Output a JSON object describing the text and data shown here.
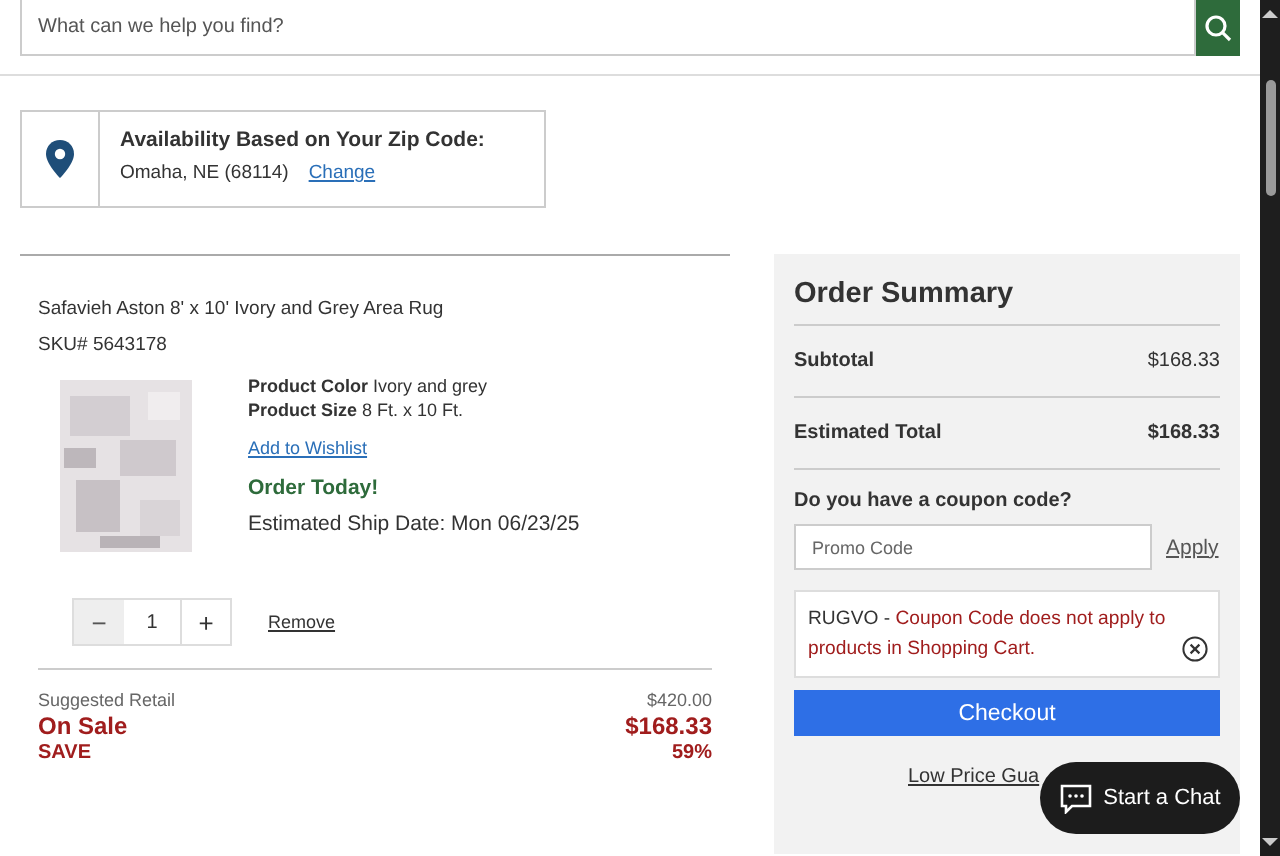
{
  "search": {
    "placeholder": "What can we help you find?"
  },
  "availability": {
    "title": "Availability Based on Your Zip Code:",
    "location": "Omaha, NE (68114)",
    "change_link": "Change"
  },
  "cart_item": {
    "name": "Safavieh Aston 8' x 10' Ivory and Grey Area Rug",
    "sku": "SKU# 5643178",
    "attributes": [
      {
        "label": "Product Color",
        "value": "Ivory and grey"
      },
      {
        "label": "Product Size",
        "value": "8 Ft. x 10 Ft."
      }
    ],
    "wishlist_link": "Add to Wishlist",
    "order_notice": "Order Today!",
    "ship_date": "Estimated Ship Date: Mon 06/23/25",
    "quantity": {
      "minus": "−",
      "value": "1",
      "plus": "+"
    },
    "remove_link": "Remove",
    "pricing": [
      {
        "kind": "regular",
        "label": "Suggested Retail",
        "value": "$420.00"
      },
      {
        "kind": "sale",
        "label": "On Sale",
        "value": "$168.33"
      },
      {
        "kind": "save",
        "label": "SAVE",
        "value": "59%"
      }
    ]
  },
  "order_summary": {
    "title": "Order Summary",
    "rows": [
      {
        "kind": "normal",
        "label": "Subtotal",
        "value": "$168.33"
      },
      {
        "kind": "total",
        "label": "Estimated Total",
        "value": "$168.33"
      }
    ],
    "coupon_prompt": "Do you have a coupon code?",
    "promo_placeholder": "Promo Code",
    "apply_link": "Apply",
    "coupon_message": {
      "code": "RUGVO -",
      "text": "Coupon Code does not apply to products in Shopping Cart."
    },
    "checkout_button": "Checkout",
    "low_price_link": "Low Price Gua"
  },
  "chat_button": "Start a Chat"
}
